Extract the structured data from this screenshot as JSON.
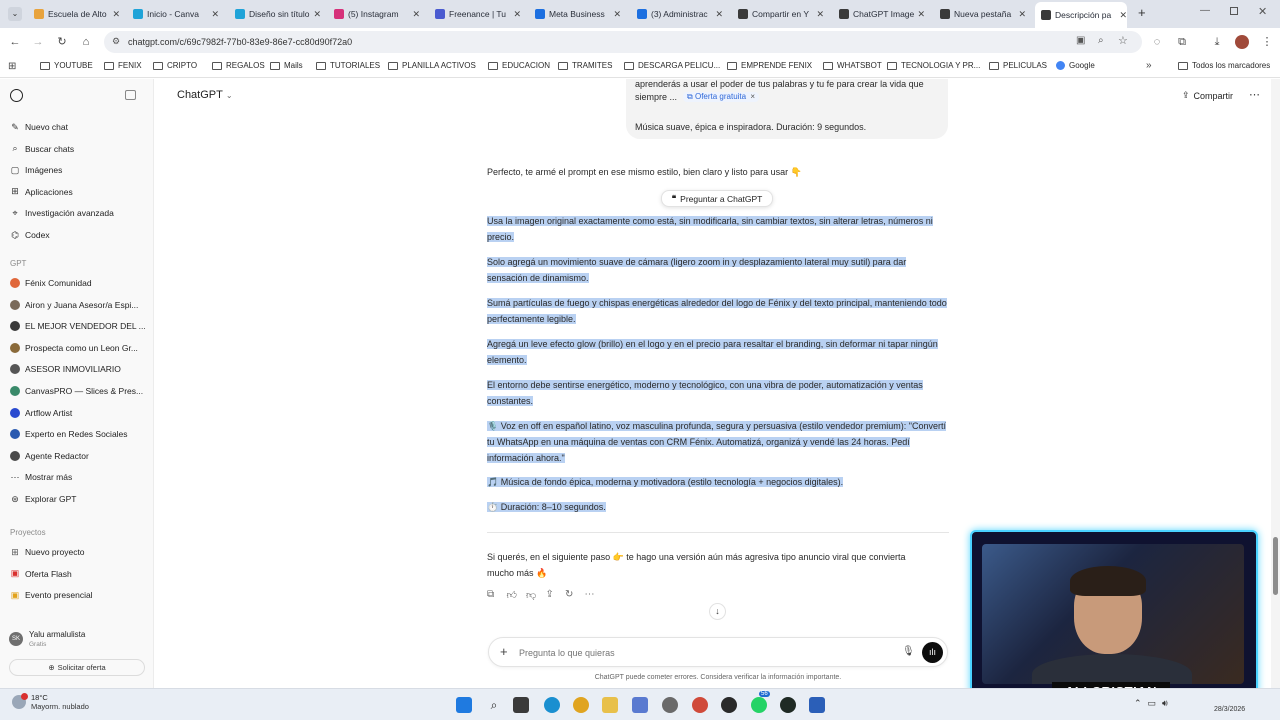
{
  "browser": {
    "tabs": [
      {
        "title": "Escuela de Alto",
        "color": "#e8a33d"
      },
      {
        "title": "Inicio - Canva",
        "color": "#1fa3d8"
      },
      {
        "title": "Diseño sin título",
        "color": "#1fa3d8"
      },
      {
        "title": "(5) Instagram",
        "color": "#d6317a"
      },
      {
        "title": "Freenance | Tu",
        "color": "#4a5bd0"
      },
      {
        "title": "Meta Business",
        "color": "#1c6fe0"
      },
      {
        "title": "(3) Administrac",
        "color": "#1c6fe0"
      },
      {
        "title": "Compartir en Y",
        "color": "#3a3a3a"
      },
      {
        "title": "ChatGPT Image",
        "color": "#3a3a3a"
      },
      {
        "title": "Nueva pestaña",
        "color": "#3a3a3a"
      },
      {
        "title": "Descripción pa",
        "color": "#3a3a3a",
        "active": true
      }
    ],
    "url": "chatgpt.com/c/69c7982f-77b0-83e9-86e7-cc80d90f72a0",
    "bookmarks": [
      "YOUTUBE",
      "FENIX",
      "CRIPTO",
      "REGALOS",
      "Mails",
      "TUTORIALES",
      "PLANILLA ACTIVOS",
      "EDUCACION",
      "TRAMITES",
      "DESCARGA PELICU...",
      "EMPRENDE FENIX",
      "WHATSBOT",
      "TECNOLOGIA Y PR...",
      "PELICULAS",
      "Google"
    ],
    "all_bookmarks": "Todos los marcadores"
  },
  "sidebar": {
    "nav": [
      {
        "label": "Nuevo chat",
        "icon": "new-chat-icon"
      },
      {
        "label": "Buscar chats",
        "icon": "search-icon"
      },
      {
        "label": "Imágenes",
        "icon": "image-icon"
      },
      {
        "label": "Aplicaciones",
        "icon": "apps-icon"
      },
      {
        "label": "Investigación avanzada",
        "icon": "research-icon"
      },
      {
        "label": "Codex",
        "icon": "codex-icon"
      }
    ],
    "gpt_title": "GPT",
    "gpts": [
      {
        "label": "Fénix Comunidad",
        "color": "#e0673a"
      },
      {
        "label": "Airon y Juana  Asesor/a Espi...",
        "color": "#7a6a5a"
      },
      {
        "label": "EL MEJOR VENDEDOR DEL ...",
        "color": "#3a3a3a"
      },
      {
        "label": "Prospecta como un Leon Gr...",
        "color": "#8a6a3a"
      },
      {
        "label": "ASESOR INMOVILIARIO",
        "color": "#555555"
      },
      {
        "label": "CanvasPRO — Slices & Pres...",
        "color": "#3a8a6a"
      },
      {
        "label": "Artflow Artist",
        "color": "#2a4ad0"
      },
      {
        "label": "Experto en Redes Sociales",
        "color": "#2a5ab0"
      },
      {
        "label": "Agente Redactor",
        "color": "#4a4a4a"
      },
      {
        "label": "Mostrar más",
        "color": ""
      },
      {
        "label": "Explorar GPT",
        "color": ""
      }
    ],
    "projects_title": "Proyectos",
    "projects": [
      "Nuevo proyecto",
      "Oferta Flash",
      "Evento presencial"
    ],
    "user_name": "Yalu armalulista",
    "user_plan": "Gratis",
    "upgrade": "Solicitar oferta",
    "user_initials": "SK"
  },
  "header": {
    "model": "ChatGPT",
    "share": "Compartir"
  },
  "chat": {
    "user_line1": "aprenderás a usar el poder de tus palabras y tu fe para crear la vida que",
    "user_line2": "siempre ...",
    "user_chip": "Oferta gratuita",
    "user_line3": "Música suave, épica e inspiradora. Duración: 9 segundos.",
    "intro": "Perfecto, te armé el prompt en ese mismo estilo, bien claro y listo para usar 👇",
    "ask_popup": "Preguntar a ChatGPT",
    "paragraphs": [
      "Usa la imagen original exactamente como está, sin modificarla, sin cambiar textos, sin alterar letras, números ni precio.",
      "Solo agregá un movimiento suave de cámara (ligero zoom in y desplazamiento lateral muy sutil) para dar sensación de dinamismo.",
      "Sumá partículas de fuego y chispas energéticas alrededor del logo de Fénix y del texto principal, manteniendo todo perfectamente legible.",
      "Agregá un leve efecto glow (brillo) en el logo y en el precio para resaltar el branding, sin deformar ni tapar ningún elemento.",
      "El entorno debe sentirse energético, moderno y tecnológico, con una vibra de poder, automatización y ventas constantes.",
      "🎙️ Voz en off en español latino, voz masculina profunda, segura y persuasiva (estilo vendedor premium): \"Convertí tu WhatsApp en una máquina de ventas con CRM Fénix. Automatizá, organizá y vendé las 24 horas. Pedí información ahora.\"",
      "🎵 Música de fondo épica, moderna y motivadora (estilo tecnología + negocios digitales).",
      "⏱️ Duración: 8–10 segundos."
    ],
    "followup": "Si querés, en el siguiente paso 👉 te hago una versión aún más agresiva tipo anuncio viral que convierta mucho más 🔥",
    "composer_placeholder": "Pregunta lo que quieras",
    "disclaimer": "ChatGPT puede cometer errores. Considera verificar la información importante."
  },
  "taskbar": {
    "weather_temp": "18°C",
    "weather_desc": "Mayorm. nublado",
    "date": "28/3/2026",
    "badge_count": "56"
  },
  "webcam": {
    "name": "ALI CRISTIAN"
  }
}
